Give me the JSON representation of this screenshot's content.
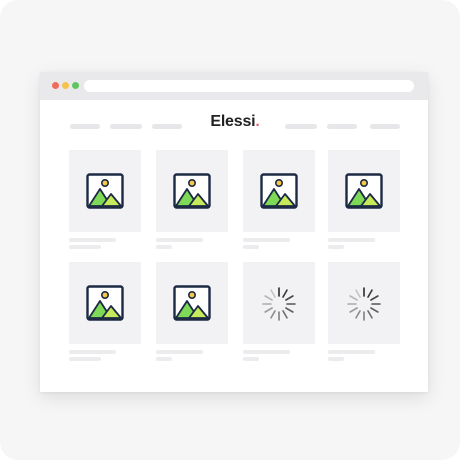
{
  "brand": {
    "name": "Elessi",
    "dot": ".",
    "accent_color": "#e06a7a"
  },
  "window": {
    "traffic_lights": [
      "#ef6b5b",
      "#f5c24d",
      "#5fc65f"
    ]
  },
  "icons": {
    "image_placeholder": "image-icon",
    "loading": "spinner-icon"
  },
  "products": [
    {
      "state": "image"
    },
    {
      "state": "image"
    },
    {
      "state": "image"
    },
    {
      "state": "image"
    },
    {
      "state": "image"
    },
    {
      "state": "image"
    },
    {
      "state": "loading"
    },
    {
      "state": "loading"
    }
  ]
}
